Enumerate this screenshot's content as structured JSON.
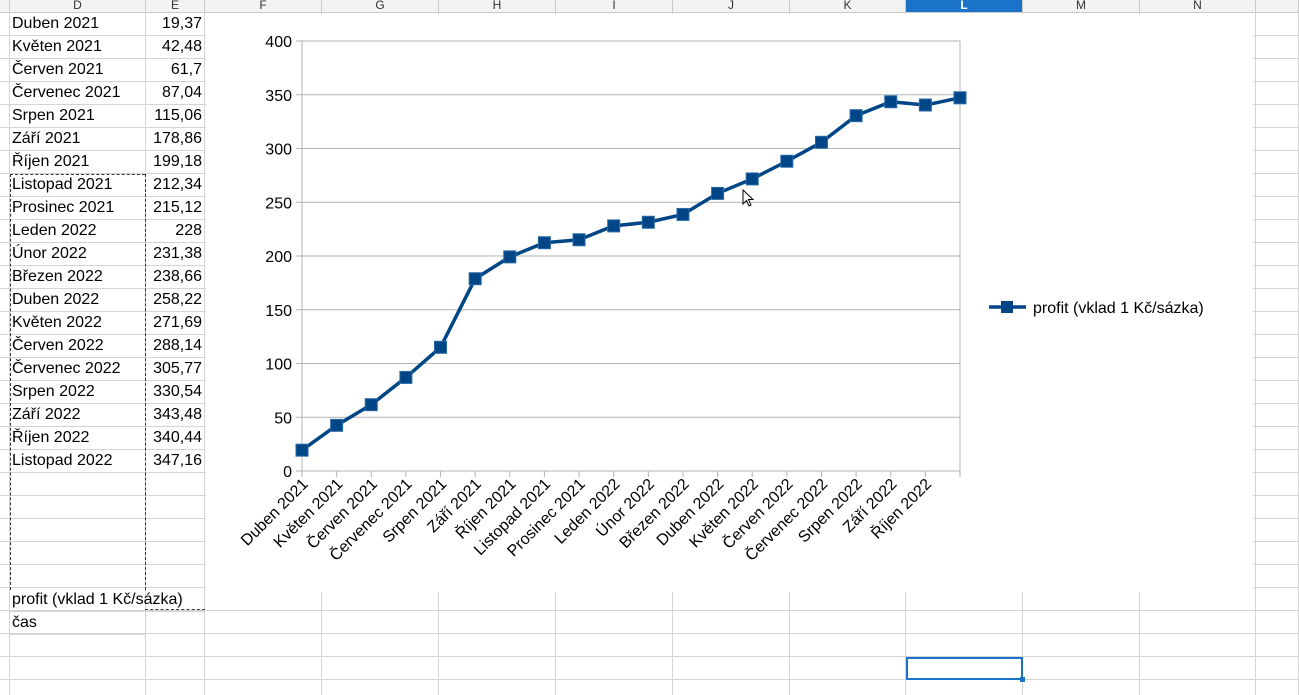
{
  "columns": [
    "D",
    "E",
    "F",
    "G",
    "H",
    "I",
    "J",
    "K",
    "L",
    "M",
    "N"
  ],
  "selected_column": "L",
  "rows": [
    {
      "label": "Duben 2021",
      "value": "19,37"
    },
    {
      "label": "Květen 2021",
      "value": "42,48"
    },
    {
      "label": "Červen 2021",
      "value": "61,7"
    },
    {
      "label": "Červenec 2021",
      "value": "87,04"
    },
    {
      "label": "Srpen 2021",
      "value": "115,06"
    },
    {
      "label": "Září 2021",
      "value": "178,86"
    },
    {
      "label": "Říjen 2021",
      "value": "199,18"
    },
    {
      "label": "Listopad 2021",
      "value": "212,34"
    },
    {
      "label": "Prosinec 2021",
      "value": "215,12"
    },
    {
      "label": "Leden 2022",
      "value": "228"
    },
    {
      "label": "Únor 2022",
      "value": "231,38"
    },
    {
      "label": "Březen 2022",
      "value": "238,66"
    },
    {
      "label": "Duben 2022",
      "value": "258,22"
    },
    {
      "label": "Květen 2022",
      "value": "271,69"
    },
    {
      "label": "Červen 2022",
      "value": "288,14"
    },
    {
      "label": "Červenec 2022",
      "value": "305,77"
    },
    {
      "label": "Srpen 2022",
      "value": "330,54"
    },
    {
      "label": "Září 2022",
      "value": "343,48"
    },
    {
      "label": "Říjen 2022",
      "value": "340,44"
    },
    {
      "label": "Listopad 2022",
      "value": "347,16"
    }
  ],
  "footer_cells": {
    "series_name_cell": "profit (vklad 1 Kč/sázka)",
    "x_title_cell": "čas"
  },
  "chart_data": {
    "type": "line",
    "categories": [
      "Duben 2021",
      "Květen 2021",
      "Červen 2021",
      "Červenec 2021",
      "Srpen 2021",
      "Září 2021",
      "Říjen 2021",
      "Listopad 2021",
      "Prosinec 2021",
      "Leden 2022",
      "Únor 2022",
      "Březen 2022",
      "Duben 2022",
      "Květen 2022",
      "Červen 2022",
      "Červenec 2022",
      "Srpen 2022",
      "Září 2022",
      "Říjen 2022"
    ],
    "x_tick_labels": [
      "Duben 2021",
      "Květen 2021",
      "Červen 2021",
      "Červenec 2021",
      "Srpen 2021",
      "Září 2021",
      "Říjen 2021",
      "Listopad 2021",
      "Prosinec 2021",
      "Leden 2022",
      "Únor 2022",
      "Březen 2022",
      "Duben 2022",
      "Květen 2022",
      "Červen 2022",
      "Červenec 2022",
      "Srpen 2022",
      "Září 2022",
      "Říjen 2022"
    ],
    "series": [
      {
        "name": "profit (vklad 1 Kč/sázka)",
        "values": [
          19.37,
          42.48,
          61.7,
          87.04,
          115.06,
          178.86,
          199.18,
          212.34,
          215.12,
          228,
          231.38,
          238.66,
          258.22,
          271.69,
          288.14,
          305.77,
          330.54,
          343.48,
          340.44,
          347.16
        ],
        "color": "#004586"
      }
    ],
    "ylim": [
      0,
      400
    ],
    "y_ticks": [
      0,
      50,
      100,
      150,
      200,
      250,
      300,
      350,
      400
    ],
    "grid": true,
    "legend": "right",
    "marker": "square"
  }
}
